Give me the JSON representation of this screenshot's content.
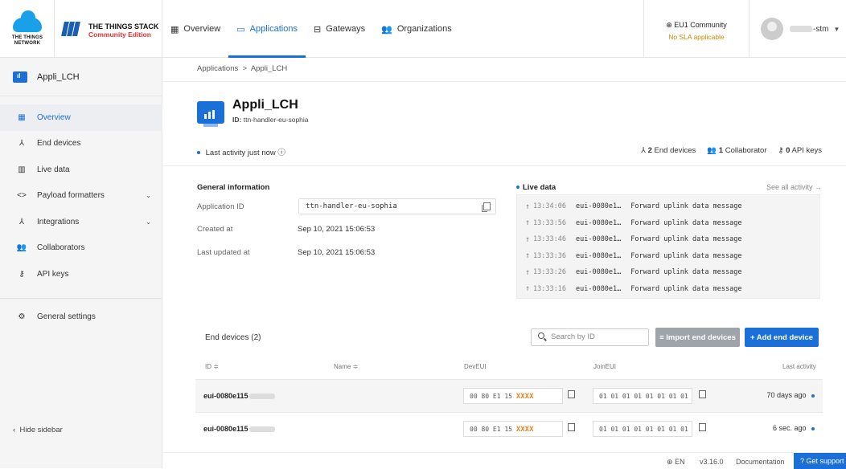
{
  "brand": {
    "ttn_text": "THE THINGS NETWORK",
    "tts_title": "THE THINGS STACK",
    "tts_subtitle": "Community Edition"
  },
  "nav": {
    "items": [
      {
        "label": "Overview",
        "icon": "grid-icon"
      },
      {
        "label": "Applications",
        "icon": "app-window-icon",
        "active": true
      },
      {
        "label": "Gateways",
        "icon": "router-icon"
      },
      {
        "label": "Organizations",
        "icon": "people-icon"
      }
    ]
  },
  "cluster": {
    "name": "EU1 Community",
    "sla": "No SLA applicable"
  },
  "user": {
    "name_suffix": "-stm"
  },
  "sidebar": {
    "app_label": "Appli_LCH",
    "items": [
      {
        "label": "Overview",
        "icon": "grid-icon",
        "active": true
      },
      {
        "label": "End devices",
        "icon": "device-icon"
      },
      {
        "label": "Live data",
        "icon": "chart-icon"
      },
      {
        "label": "Payload formatters",
        "icon": "code-icon",
        "chevron": true
      },
      {
        "label": "Integrations",
        "icon": "integration-icon",
        "chevron": true
      },
      {
        "label": "Collaborators",
        "icon": "people-icon"
      },
      {
        "label": "API keys",
        "icon": "key-icon"
      }
    ],
    "settings_label": "General settings",
    "hide_label": "Hide sidebar"
  },
  "breadcrumb": {
    "root": "Applications",
    "separator": ">",
    "current": "Appli_LCH"
  },
  "app": {
    "title": "Appli_LCH",
    "id_label": "ID:",
    "id_value": "ttn-handler-eu-sophia",
    "activity": "Last activity just now"
  },
  "stats": {
    "end_devices_count": "2",
    "end_devices_label": "End devices",
    "collaborators_count": "1",
    "collaborators_label": "Collaborator",
    "api_keys_count": "0",
    "api_keys_label": "API keys"
  },
  "general": {
    "title": "General information",
    "rows": [
      {
        "label": "Application ID",
        "value": "ttn-handler-eu-sophia"
      },
      {
        "label": "Created at",
        "value": "Sep 10, 2021 15:06:53"
      },
      {
        "label": "Last updated at",
        "value": "Sep 10, 2021 15:06:53"
      }
    ]
  },
  "live_data": {
    "title": "Live data",
    "see_all": "See all activity →",
    "entries": [
      {
        "time": "13:34:06",
        "eui": "eui-0080e1…",
        "message": "Forward uplink data message"
      },
      {
        "time": "13:33:56",
        "eui": "eui-0080e1…",
        "message": "Forward uplink data message"
      },
      {
        "time": "13:33:46",
        "eui": "eui-0080e1…",
        "message": "Forward uplink data message"
      },
      {
        "time": "13:33:36",
        "eui": "eui-0080e1…",
        "message": "Forward uplink data message"
      },
      {
        "time": "13:33:26",
        "eui": "eui-0080e1…",
        "message": "Forward uplink data message"
      },
      {
        "time": "13:33:16",
        "eui": "eui-0080e1…",
        "message": "Forward uplink data message"
      }
    ]
  },
  "end_devices": {
    "title": "End devices (2)",
    "search_placeholder": "Search by ID",
    "import_label": "Import end devices",
    "add_label": "+ Add end device",
    "columns": [
      "ID ≑",
      "Name ≑",
      "DevEUI",
      "JoinEUI",
      "Last activity"
    ],
    "rows": [
      {
        "id": "eui-0080e115",
        "deveui_prefix": "00 80 E1 15",
        "deveui_mask": "XXXX",
        "joineui": "01 01 01 01 01 01 01 01",
        "last": "70 days ago"
      },
      {
        "id": "eui-0080e115",
        "deveui_prefix": "00 80 E1 15",
        "deveui_mask": "XXXX",
        "joineui": "01 01 01 01 01 01 01 01",
        "last": "6 sec. ago"
      }
    ]
  },
  "footer": {
    "lang": "EN",
    "version": "v3.16.0",
    "docs": "Documentation",
    "support": "Get support"
  }
}
